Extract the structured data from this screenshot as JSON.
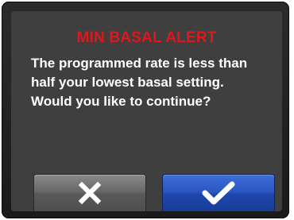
{
  "alert": {
    "title": "MIN BASAL ALERT",
    "message_lines": [
      "The programmed rate is less than",
      "half your lowest basal setting.",
      "Would you like to continue?"
    ]
  },
  "buttons": {
    "cancel": {
      "icon": "x-icon"
    },
    "confirm": {
      "icon": "check-icon"
    }
  },
  "colors": {
    "title": "#e0161c",
    "text": "#ffffff",
    "screen_background": "#3f3f3f",
    "cancel_button": "#666666",
    "confirm_button": "#2a56c0"
  }
}
